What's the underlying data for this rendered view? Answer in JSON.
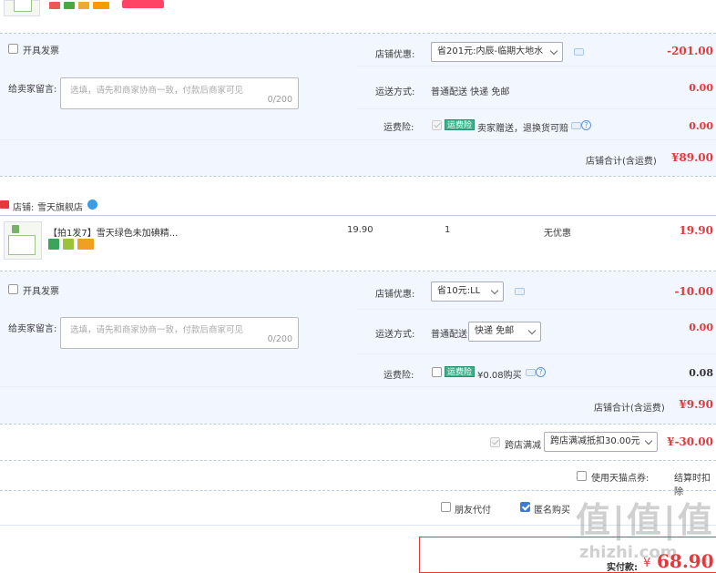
{
  "colors": {
    "price_red": "#e4393c",
    "section_bg": "#f2f7ff",
    "insurance_green": "#3db28a",
    "accent_blue": "#3b7bd6"
  },
  "store1": {
    "invoice_label": "开具发票",
    "discount_label": "店铺优惠:",
    "discount_select": "省201元:内辰-临期大地水",
    "discount_amount": "-201.00",
    "message_label": "给卖家留言:",
    "message_placeholder": "选填，请先和商家协商一致，付款后商家可见",
    "message_count": "0/200",
    "shipping_label": "运送方式:",
    "shipping_value": "普通配送 快递 免邮",
    "shipping_amount": "0.00",
    "insurance_label": "运费险:",
    "insurance_badge": "运费险",
    "insurance_text": "卖家赠送，退换货可赔",
    "insurance_amount": "0.00",
    "total_label": "店铺合计(含运费)",
    "total_value": "¥89.00"
  },
  "store2": {
    "store_label": "店铺:",
    "store_name": "雪天旗舰店",
    "product_title": "【拍1发7】雪天绿色未加碘精...",
    "unit_price": "19.90",
    "quantity": "1",
    "promo": "无优惠",
    "subtotal": "19.90",
    "invoice_label": "开具发票",
    "discount_label": "店铺优惠:",
    "discount_select": "省10元:LL",
    "discount_amount": "-10.00",
    "message_label": "给卖家留言:",
    "message_placeholder": "选填，请先和商家协商一致，付款后商家可见",
    "message_count": "0/200",
    "shipping_label": "运送方式:",
    "shipping_value": "普通配送",
    "shipping_select": "快递 免邮",
    "shipping_amount": "0.00",
    "insurance_label": "运费险:",
    "insurance_badge": "运费险",
    "insurance_text": "¥0.08购买",
    "insurance_amount": "0.08",
    "total_label": "店铺合计(含运费)",
    "total_value": "¥9.90"
  },
  "cross_store": {
    "label": "跨店满减",
    "select": "跨店满减抵扣30.00元",
    "amount": "¥-30.00"
  },
  "points": {
    "use_points_label": "使用天猫点券:",
    "settle_label": "结算时扣除"
  },
  "options": {
    "friend_pay": "朋友代付",
    "anonymous": "匿名购买"
  },
  "payment": {
    "label": "实付款:",
    "currency": "¥",
    "amount": "68.90"
  },
  "watermark": {
    "chars": "值|值|值",
    "domain": "zhizhi.com"
  }
}
